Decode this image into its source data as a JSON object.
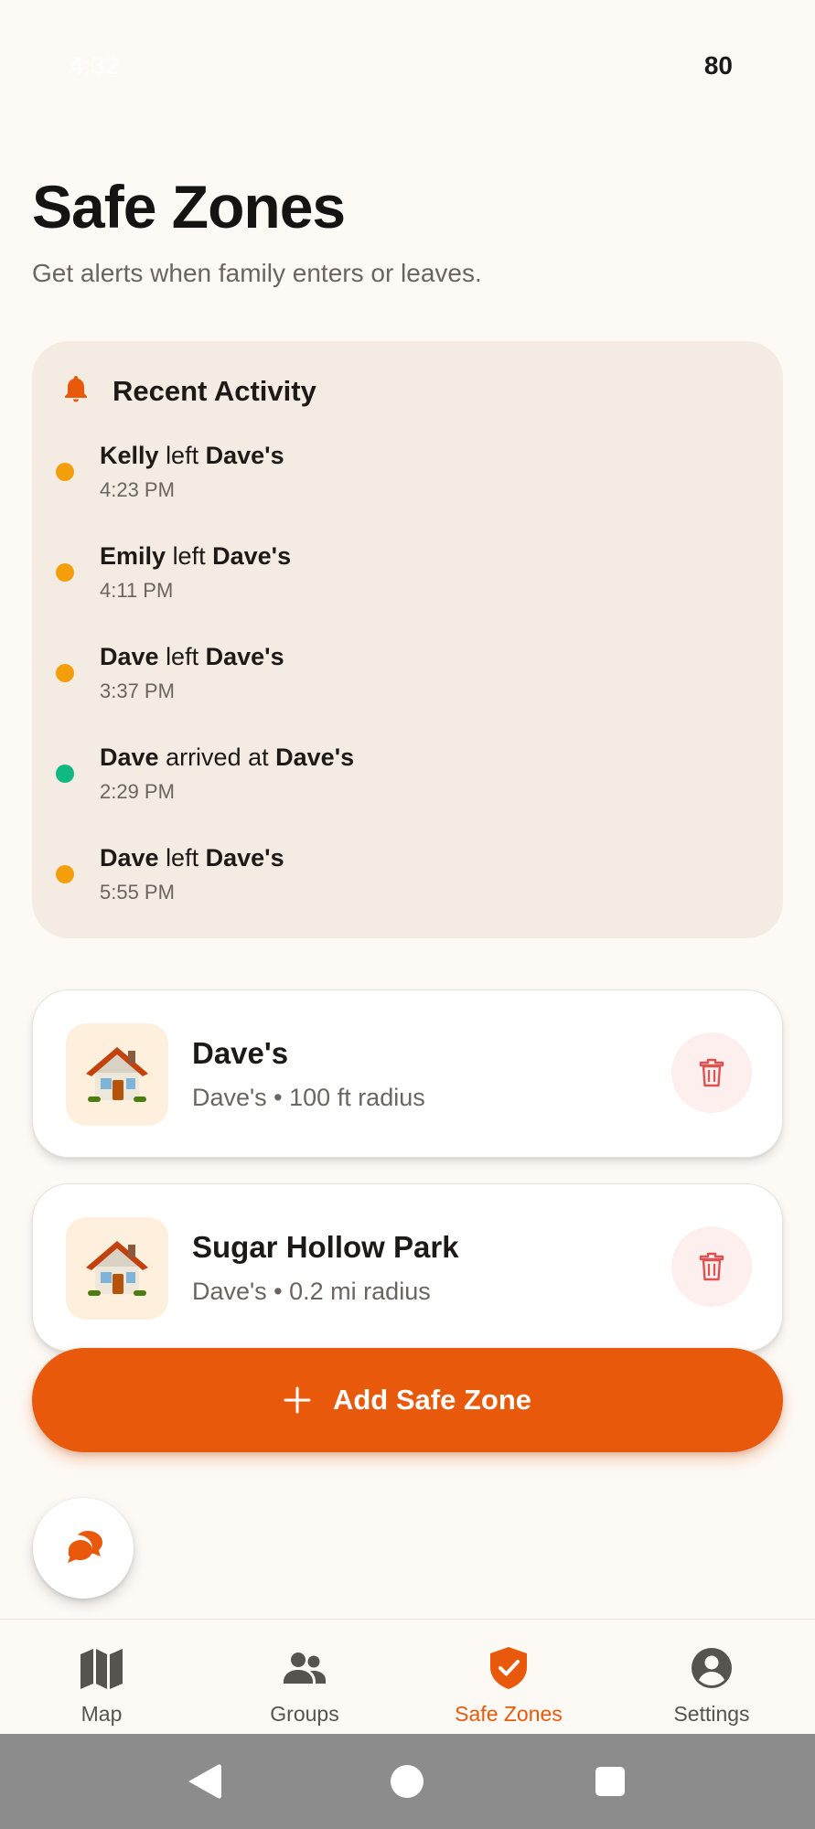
{
  "status_bar": {
    "time": "4:32",
    "battery": "80"
  },
  "header": {
    "title": "Safe Zones",
    "subtitle": "Get alerts when family enters or leaves."
  },
  "recent_activity": {
    "title": "Recent Activity",
    "items": [
      {
        "person": "Kelly",
        "action": "left",
        "place": "Dave's",
        "time": "4:23 PM",
        "status": "left",
        "dot_color": "#f59e0b"
      },
      {
        "person": "Emily",
        "action": "left",
        "place": "Dave's",
        "time": "4:11 PM",
        "status": "left",
        "dot_color": "#f59e0b"
      },
      {
        "person": "Dave",
        "action": "left",
        "place": "Dave's",
        "time": "3:37 PM",
        "status": "left",
        "dot_color": "#f59e0b"
      },
      {
        "person": "Dave",
        "action": "arrived at",
        "place": "Dave's",
        "time": "2:29 PM",
        "status": "arrived",
        "dot_color": "#10b981"
      },
      {
        "person": "Dave",
        "action": "left",
        "place": "Dave's",
        "time": "5:55 PM",
        "status": "left",
        "dot_color": "#f59e0b"
      }
    ]
  },
  "zones": [
    {
      "name": "Dave's",
      "detail": "Dave's • 100 ft radius",
      "icon": "house-icon"
    },
    {
      "name": "Sugar Hollow Park",
      "detail": "Dave's • 0.2 mi radius",
      "icon": "house-icon"
    }
  ],
  "add_button": {
    "label": "Add Safe Zone"
  },
  "bottom_nav": {
    "items": [
      {
        "label": "Map",
        "icon": "map-icon",
        "active": false
      },
      {
        "label": "Groups",
        "icon": "groups-icon",
        "active": false
      },
      {
        "label": "Safe Zones",
        "icon": "shield-check-icon",
        "active": true
      },
      {
        "label": "Settings",
        "icon": "account-icon",
        "active": false
      }
    ]
  },
  "colors": {
    "accent": "#e8590c",
    "background": "#fdfaf6",
    "activity_card": "#f4ece2",
    "left_status": "#f59e0b",
    "arrived_status": "#10b981",
    "delete": "#e05252"
  }
}
